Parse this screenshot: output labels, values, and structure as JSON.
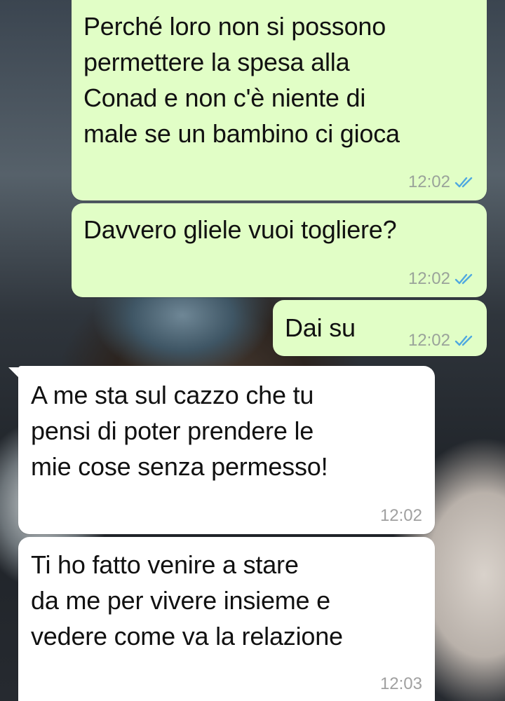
{
  "messages": [
    {
      "direction": "outgoing",
      "lines": [
        "Perché loro non si possono",
        "permettere la spesa alla",
        "Conad e non c'è niente di",
        "male se un bambino ci gioca"
      ],
      "time": "12:02",
      "status_icon": "double-check-read-icon"
    },
    {
      "direction": "outgoing",
      "lines": [
        "Davvero gliele vuoi togliere?"
      ],
      "time": "12:02",
      "status_icon": "double-check-read-icon"
    },
    {
      "direction": "outgoing",
      "lines": [
        "Dai su"
      ],
      "time": "12:02",
      "status_icon": "double-check-read-icon"
    },
    {
      "direction": "incoming",
      "lines": [
        "A me sta sul cazzo che tu",
        "pensi di poter prendere le",
        "mie cose senza permesso!"
      ],
      "time": "12:02"
    },
    {
      "direction": "incoming",
      "lines": [
        "Ti ho fatto venire a stare",
        "da me per vivere insieme e",
        "vedere come va la relazione"
      ],
      "time": "12:03"
    }
  ],
  "colors": {
    "outgoing_bubble": "#e1fec6",
    "incoming_bubble": "#ffffff",
    "read_check": "#4fa8e0"
  }
}
